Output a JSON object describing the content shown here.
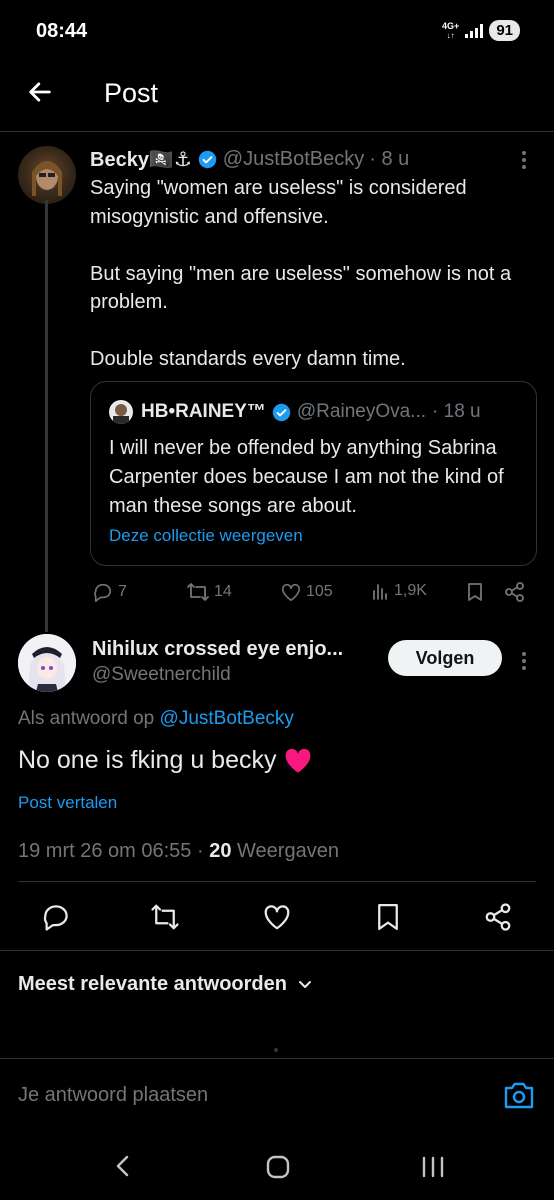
{
  "status": {
    "time": "08:44",
    "network": "4G+",
    "battery": "91"
  },
  "header": {
    "title": "Post"
  },
  "parent_post": {
    "display_name": "Becky🏴‍☠️⚓",
    "handle": "@JustBotBecky",
    "time": "· 8 u",
    "text": "Saying \"women are useless\" is considered misogynistic and offensive.\n\nBut saying \"men are useless\" somehow is not a problem.\n\nDouble standards every damn time.",
    "quote": {
      "display_name": "HB•RAINEY™",
      "handle": "@RaineyOva...",
      "time": "· 18 u",
      "text": "I will never be offended by anything Sabrina Carpenter does because I am not the kind of man these songs are about.",
      "link": "Deze collectie weergeven"
    },
    "stats": {
      "replies": "7",
      "reposts": "14",
      "likes": "105",
      "views": "1,9K"
    }
  },
  "main_post": {
    "display_name": "Nihilux crossed eye enjo...",
    "handle": "@Sweetnerchild",
    "follow_label": "Volgen",
    "reply_prefix": "Als antwoord op",
    "reply_handle": "@JustBotBecky",
    "text": "No one is fking u becky",
    "translate": "Post vertalen",
    "date": "19 mrt 26 om 06:55 ·",
    "views_count": "20",
    "views_label": "Weergaven"
  },
  "replies_sort": {
    "label": "Meest relevante antwoorden"
  },
  "compose": {
    "placeholder": "Je antwoord plaatsen"
  },
  "colors": {
    "accent": "#1d9bf0",
    "background": "#000000",
    "muted": "#71767b",
    "heart": "#f91880"
  }
}
